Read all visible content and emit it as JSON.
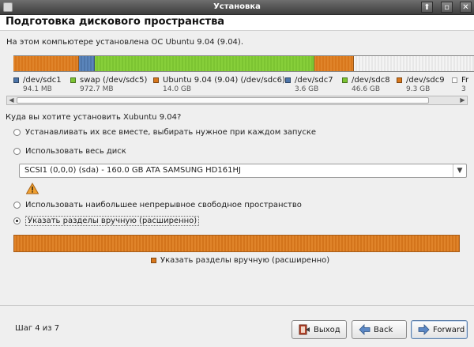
{
  "window": {
    "title": "Установка",
    "controls": {
      "pin": "⬆",
      "maximize": "▫",
      "close": "✕"
    }
  },
  "page_title": "Подготовка дискового пространства",
  "info_text": "На этом компьютере установлена ОС Ubuntu 9.04 (9.04).",
  "disk_bar": {
    "segments": [
      {
        "color": "#d8771c",
        "fraction": 0.142
      },
      {
        "color": "#4e76aa",
        "fraction": 0.034
      },
      {
        "color": "#7cc432",
        "fraction": 0.478
      },
      {
        "color": "#d8771c",
        "fraction": 0.085
      },
      {
        "color": "#e9e9e9",
        "fraction": 0.261
      }
    ]
  },
  "legend": [
    {
      "name": "/dev/sdc1",
      "size": "94.1 MB",
      "color": "#4e76aa"
    },
    {
      "name": "swap (/dev/sdc5)",
      "size": "972.7 MB",
      "color": "#7cc432"
    },
    {
      "name": "Ubuntu 9.04 (9.04) (/dev/sdc6)",
      "size": "14.0 GB",
      "color": "#d8771c"
    },
    {
      "name": "/dev/sdc7",
      "size": "3.6 GB",
      "color": "#4e76aa"
    },
    {
      "name": "/dev/sdc8",
      "size": "46.6 GB",
      "color": "#7cc432"
    },
    {
      "name": "/dev/sdc9",
      "size": "9.3 GB",
      "color": "#d8771c"
    },
    {
      "name": "Fr",
      "size": "3",
      "color": "#ffffff"
    }
  ],
  "question": "Куда вы хотите установить Xubuntu 9.04?",
  "options": {
    "side_by_side": "Устанавливать их все вместе, выбирать нужное при каждом запуске",
    "use_entire_disk": "Использовать весь диск",
    "largest_free": "Использовать наибольшее непрерывное свободное пространство",
    "manual": "Указать разделы вручную (расширенно)"
  },
  "selected_option": "manual",
  "disk_select": {
    "value": "SCSI1 (0,0,0) (sda) - 160.0 GB ATA SAMSUNG HD161HJ"
  },
  "result_legend": "Указать разделы вручную (расширенно)",
  "step": "Шаг 4 из 7",
  "buttons": {
    "quit": "Выход",
    "back": "Back",
    "forward": "Forward"
  },
  "icons": {
    "warning": "warning-icon",
    "quit": "exit-door-icon",
    "back": "arrow-left-icon",
    "forward": "arrow-right-icon"
  }
}
